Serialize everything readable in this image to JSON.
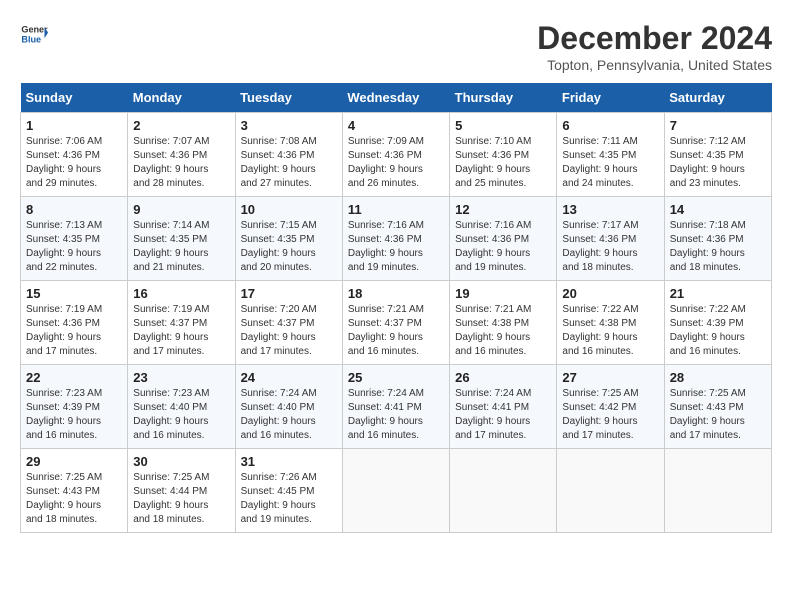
{
  "header": {
    "logo_line1": "General",
    "logo_line2": "Blue",
    "title": "December 2024",
    "subtitle": "Topton, Pennsylvania, United States"
  },
  "days_of_week": [
    "Sunday",
    "Monday",
    "Tuesday",
    "Wednesday",
    "Thursday",
    "Friday",
    "Saturday"
  ],
  "weeks": [
    [
      {
        "day": 1,
        "info": "Sunrise: 7:06 AM\nSunset: 4:36 PM\nDaylight: 9 hours\nand 29 minutes."
      },
      {
        "day": 2,
        "info": "Sunrise: 7:07 AM\nSunset: 4:36 PM\nDaylight: 9 hours\nand 28 minutes."
      },
      {
        "day": 3,
        "info": "Sunrise: 7:08 AM\nSunset: 4:36 PM\nDaylight: 9 hours\nand 27 minutes."
      },
      {
        "day": 4,
        "info": "Sunrise: 7:09 AM\nSunset: 4:36 PM\nDaylight: 9 hours\nand 26 minutes."
      },
      {
        "day": 5,
        "info": "Sunrise: 7:10 AM\nSunset: 4:36 PM\nDaylight: 9 hours\nand 25 minutes."
      },
      {
        "day": 6,
        "info": "Sunrise: 7:11 AM\nSunset: 4:35 PM\nDaylight: 9 hours\nand 24 minutes."
      },
      {
        "day": 7,
        "info": "Sunrise: 7:12 AM\nSunset: 4:35 PM\nDaylight: 9 hours\nand 23 minutes."
      }
    ],
    [
      {
        "day": 8,
        "info": "Sunrise: 7:13 AM\nSunset: 4:35 PM\nDaylight: 9 hours\nand 22 minutes."
      },
      {
        "day": 9,
        "info": "Sunrise: 7:14 AM\nSunset: 4:35 PM\nDaylight: 9 hours\nand 21 minutes."
      },
      {
        "day": 10,
        "info": "Sunrise: 7:15 AM\nSunset: 4:35 PM\nDaylight: 9 hours\nand 20 minutes."
      },
      {
        "day": 11,
        "info": "Sunrise: 7:16 AM\nSunset: 4:36 PM\nDaylight: 9 hours\nand 19 minutes."
      },
      {
        "day": 12,
        "info": "Sunrise: 7:16 AM\nSunset: 4:36 PM\nDaylight: 9 hours\nand 19 minutes."
      },
      {
        "day": 13,
        "info": "Sunrise: 7:17 AM\nSunset: 4:36 PM\nDaylight: 9 hours\nand 18 minutes."
      },
      {
        "day": 14,
        "info": "Sunrise: 7:18 AM\nSunset: 4:36 PM\nDaylight: 9 hours\nand 18 minutes."
      }
    ],
    [
      {
        "day": 15,
        "info": "Sunrise: 7:19 AM\nSunset: 4:36 PM\nDaylight: 9 hours\nand 17 minutes."
      },
      {
        "day": 16,
        "info": "Sunrise: 7:19 AM\nSunset: 4:37 PM\nDaylight: 9 hours\nand 17 minutes."
      },
      {
        "day": 17,
        "info": "Sunrise: 7:20 AM\nSunset: 4:37 PM\nDaylight: 9 hours\nand 17 minutes."
      },
      {
        "day": 18,
        "info": "Sunrise: 7:21 AM\nSunset: 4:37 PM\nDaylight: 9 hours\nand 16 minutes."
      },
      {
        "day": 19,
        "info": "Sunrise: 7:21 AM\nSunset: 4:38 PM\nDaylight: 9 hours\nand 16 minutes."
      },
      {
        "day": 20,
        "info": "Sunrise: 7:22 AM\nSunset: 4:38 PM\nDaylight: 9 hours\nand 16 minutes."
      },
      {
        "day": 21,
        "info": "Sunrise: 7:22 AM\nSunset: 4:39 PM\nDaylight: 9 hours\nand 16 minutes."
      }
    ],
    [
      {
        "day": 22,
        "info": "Sunrise: 7:23 AM\nSunset: 4:39 PM\nDaylight: 9 hours\nand 16 minutes."
      },
      {
        "day": 23,
        "info": "Sunrise: 7:23 AM\nSunset: 4:40 PM\nDaylight: 9 hours\nand 16 minutes."
      },
      {
        "day": 24,
        "info": "Sunrise: 7:24 AM\nSunset: 4:40 PM\nDaylight: 9 hours\nand 16 minutes."
      },
      {
        "day": 25,
        "info": "Sunrise: 7:24 AM\nSunset: 4:41 PM\nDaylight: 9 hours\nand 16 minutes."
      },
      {
        "day": 26,
        "info": "Sunrise: 7:24 AM\nSunset: 4:41 PM\nDaylight: 9 hours\nand 17 minutes."
      },
      {
        "day": 27,
        "info": "Sunrise: 7:25 AM\nSunset: 4:42 PM\nDaylight: 9 hours\nand 17 minutes."
      },
      {
        "day": 28,
        "info": "Sunrise: 7:25 AM\nSunset: 4:43 PM\nDaylight: 9 hours\nand 17 minutes."
      }
    ],
    [
      {
        "day": 29,
        "info": "Sunrise: 7:25 AM\nSunset: 4:43 PM\nDaylight: 9 hours\nand 18 minutes."
      },
      {
        "day": 30,
        "info": "Sunrise: 7:25 AM\nSunset: 4:44 PM\nDaylight: 9 hours\nand 18 minutes."
      },
      {
        "day": 31,
        "info": "Sunrise: 7:26 AM\nSunset: 4:45 PM\nDaylight: 9 hours\nand 19 minutes."
      },
      null,
      null,
      null,
      null
    ]
  ]
}
